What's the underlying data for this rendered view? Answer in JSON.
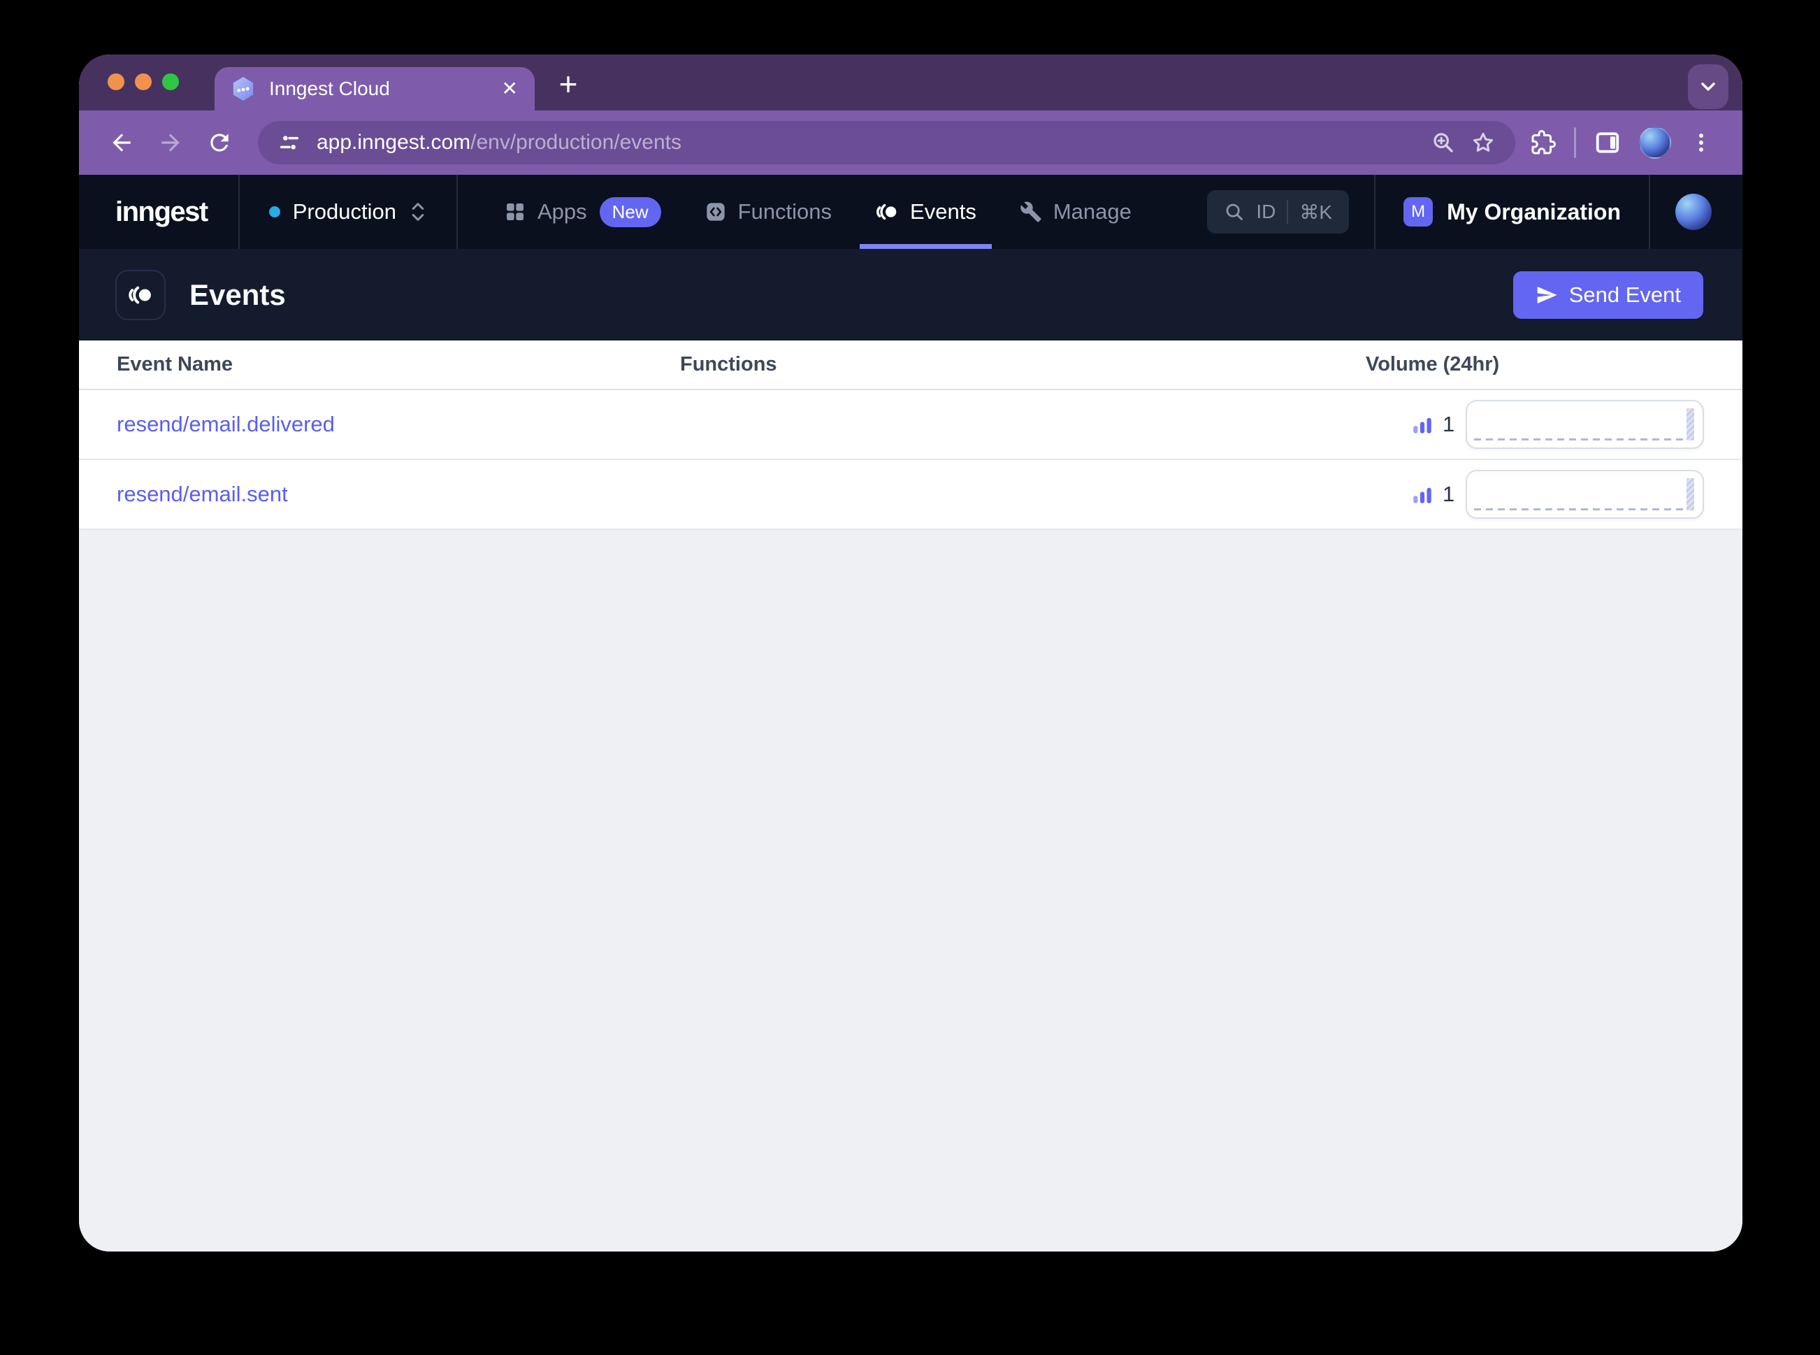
{
  "browser": {
    "tab_title": "Inngest Cloud",
    "close_glyph": "✕",
    "new_tab_glyph": "+",
    "url_host": "app.inngest.com",
    "url_path": "/env/production/events"
  },
  "nav": {
    "logo": "inngest",
    "environment": {
      "label": "Production"
    },
    "items": [
      {
        "label": "Apps",
        "badge": "New"
      },
      {
        "label": "Functions"
      },
      {
        "label": "Events",
        "active": true
      },
      {
        "label": "Manage"
      }
    ],
    "search": {
      "label": "ID",
      "shortcut": "⌘K"
    },
    "organization": {
      "initial": "M",
      "name": "My Organization"
    }
  },
  "page": {
    "title": "Events",
    "send_event_label": "Send Event"
  },
  "table": {
    "columns": [
      "Event Name",
      "Functions",
      "Volume (24hr)"
    ],
    "rows": [
      {
        "name": "resend/email.delivered",
        "functions": "",
        "volume": "1"
      },
      {
        "name": "resend/email.sent",
        "functions": "",
        "volume": "1"
      }
    ]
  },
  "icons": {
    "favicon": "inngest-hexagon",
    "events": "double-arc-circle",
    "functions": "code-brackets-square",
    "apps": "grid-2x2",
    "manage": "wrench",
    "send": "paper-plane",
    "volume": "bar-chart"
  },
  "colors": {
    "accent": "#6366f1",
    "link": "#5a5ef0",
    "underline": "#7e85f2",
    "nav_bg": "#0a101d",
    "header_bg": "#131b2d",
    "tabstrip": "#47325f",
    "toolbar": "#7e5cab",
    "env_dot": "#2aa9e8",
    "body_bg": "#eef0f4"
  }
}
